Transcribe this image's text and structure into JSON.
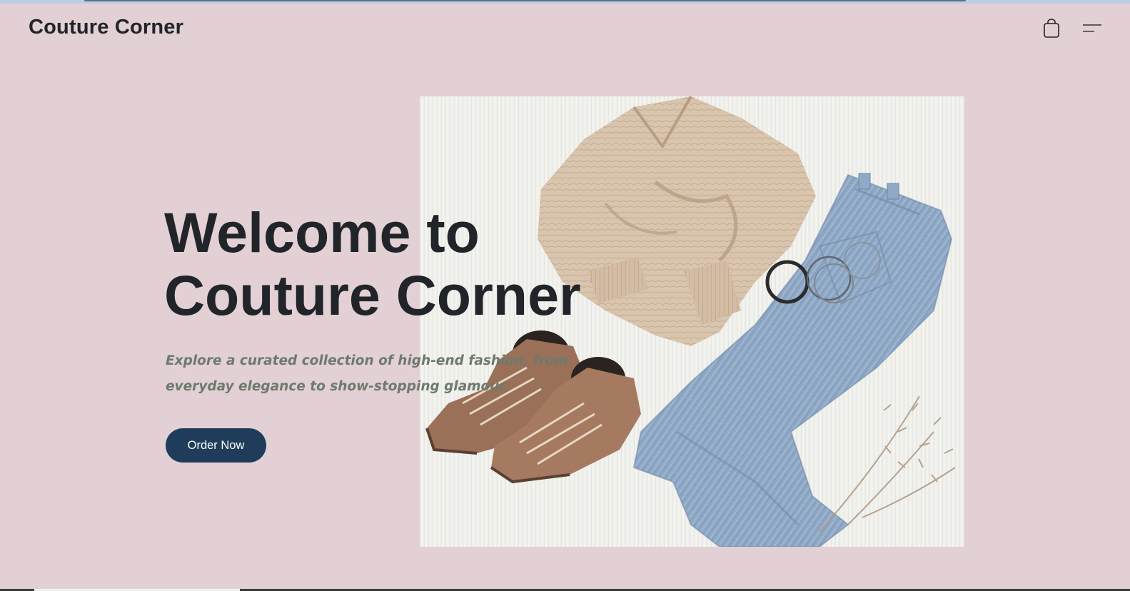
{
  "header": {
    "brand": "Couture Corner",
    "cart_icon": "shopping-bag-icon",
    "menu_icon": "hamburger-menu-icon"
  },
  "hero": {
    "title_line1": "Welcome to",
    "title_line2": "Couture Corner",
    "subtitle": "Explore a curated collection of high-end fashion, from everyday elegance to show-stopping glamour.",
    "cta_label": "Order Now",
    "image_subject": "flat-lay of beige knit sweater, light-wash jeans, brown lace-up boots, bangles and dried grass"
  },
  "colors": {
    "background": "#e2d0d5",
    "text_dark": "#212529",
    "subtitle": "#6d7a6d",
    "button": "#1f3d5b",
    "button_text": "#ffffff"
  }
}
